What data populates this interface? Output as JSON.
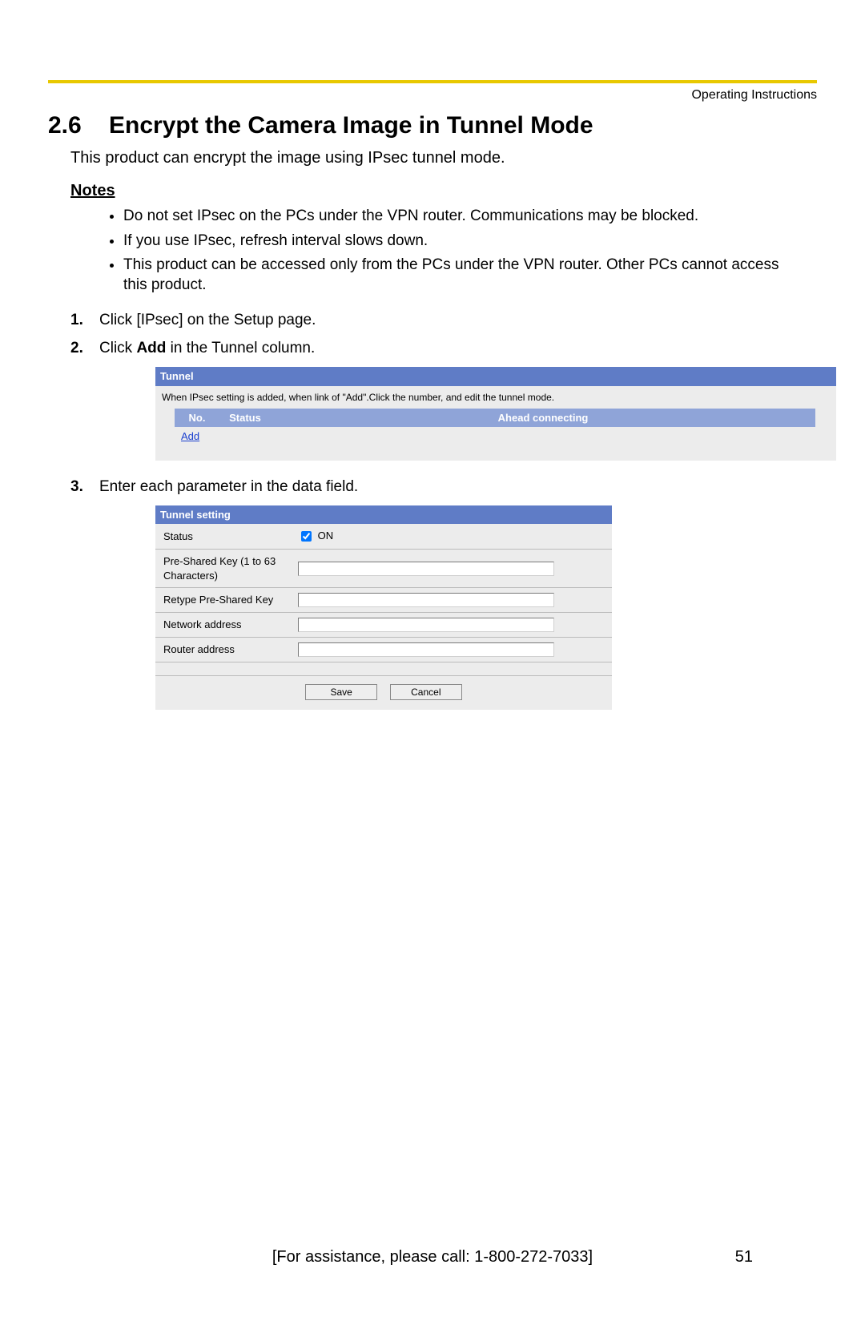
{
  "header_label": "Operating Instructions",
  "section_number": "2.6",
  "section_title": "Encrypt the Camera Image in Tunnel Mode",
  "intro": "This product can encrypt the image using IPsec tunnel mode.",
  "notes_heading": "Notes",
  "notes": [
    "Do not set IPsec on the PCs under the VPN router. Communications may be blocked.",
    "If you use IPsec, refresh interval slows down.",
    "This product can be accessed only from the PCs under the VPN router. Other PCs cannot access this product."
  ],
  "step1": "Click [IPsec] on the Setup page.",
  "step2_prefix": "Click ",
  "step2_bold": "Add",
  "step2_suffix": " in the Tunnel column.",
  "step3": "Enter each parameter in the data field.",
  "tunnel": {
    "panel_title": "Tunnel",
    "description": "When IPsec setting is added, when link of \"Add\".Click the number, and edit the tunnel mode.",
    "col_no": "No.",
    "col_status": "Status",
    "col_ahead": "Ahead connecting",
    "add_link": "Add"
  },
  "settings": {
    "panel_title": "Tunnel setting",
    "status_label": "Status",
    "status_checkbox_text": "ON",
    "psk_label": "Pre-Shared Key (1 to 63 Characters)",
    "retype_label": "Retype Pre-Shared Key",
    "network_label": "Network address",
    "router_label": "Router address",
    "save_btn": "Save",
    "cancel_btn": "Cancel"
  },
  "footer_text": "[For assistance, please call: 1-800-272-7033]",
  "page_number": "51"
}
